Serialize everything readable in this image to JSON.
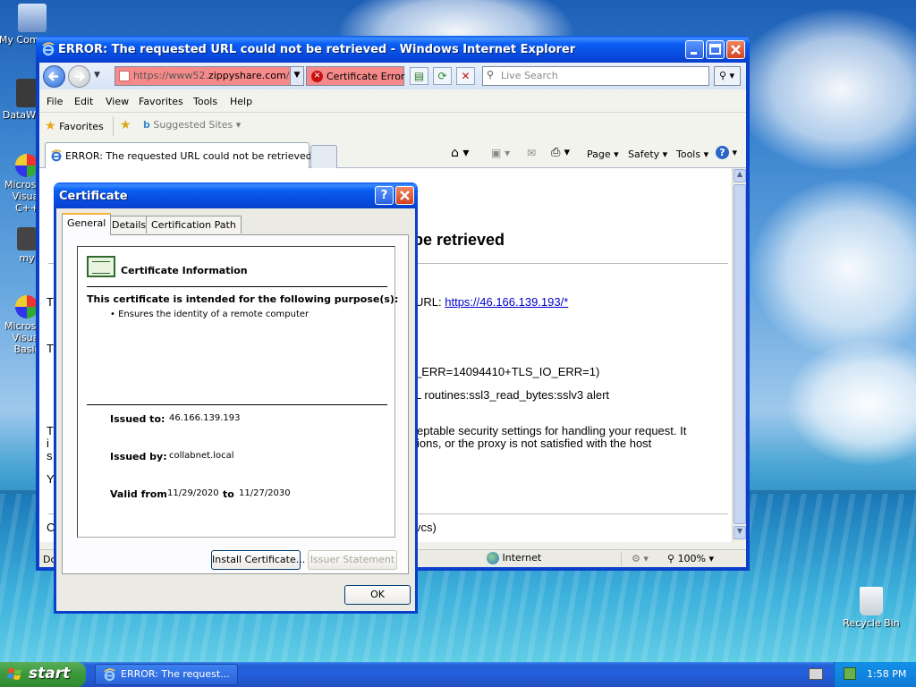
{
  "desktop": {
    "icons": [
      {
        "label": "My Computer",
        "name": "my-computer"
      },
      {
        "label": "DataWare",
        "name": "dataware"
      },
      {
        "label": "Microsoft Visual C++",
        "name": "microsoft-visual-cpp"
      },
      {
        "label": "my",
        "name": "my-shortcut"
      },
      {
        "label": "Microsoft Visual Basic",
        "name": "microsoft-visual-basic"
      },
      {
        "label": "Recycle Bin",
        "name": "recycle-bin"
      }
    ]
  },
  "ie_window": {
    "title": "ERROR: The requested URL could not be retrieved - Windows Internet Explorer",
    "address_prefix": "https://www52.",
    "address_host": "zippyshare.com",
    "address_suffix": "/v/",
    "cert_error": "Certificate Error",
    "search_placeholder": "Live Search",
    "menu": [
      "File",
      "Edit",
      "View",
      "Favorites",
      "Tools",
      "Help"
    ],
    "favorites_label": "Favorites",
    "suggested_sites": "Suggested Sites",
    "tab_title": "ERROR: The requested URL could not be retrieved",
    "commands": {
      "page": "Page",
      "safety": "Safety",
      "tools": "Tools"
    },
    "page": {
      "heading": "be retrieved",
      "url_line_prefix": "URL: ",
      "url_link": "https://46.166.139.193/*",
      "err_line1": "_ERR=14094410+TLS_IO_ERR=1)",
      "err_line2": "L routines:ssl3_read_bytes:sslv3 alert",
      "para_line1": "eptable security settings for handling your request. It",
      "para_line2": "ions, or the proxy is not satisfied with the host",
      "footer_frag": "vcs)"
    },
    "status": {
      "left": "Dor",
      "zone": "Internet",
      "zoom": "100%"
    }
  },
  "cert_dialog": {
    "title": "Certificate",
    "tabs": [
      "General",
      "Details",
      "Certification Path"
    ],
    "info_title": "Certificate Information",
    "purpose_heading": "This certificate is intended for the following purpose(s):",
    "purpose_item": "• Ensures the identity of a remote computer",
    "issued_to_label": "Issued to:",
    "issued_to": "46.166.139.193",
    "issued_by_label": "Issued by:",
    "issued_by": "collabnet.local",
    "valid_from_label": "Valid from",
    "valid_from": "11/29/2020",
    "valid_to_label": "to",
    "valid_to": "11/27/2030",
    "install_button": "Install Certificate...",
    "issuer_button": "Issuer Statement",
    "ok_button": "OK"
  },
  "taskbar": {
    "start": "start",
    "task_label": "ERROR: The request...",
    "clock": "1:58 PM"
  },
  "colors": {
    "cert_error_bg": "#f68a8a",
    "title_bar": "#0a58ec",
    "taskbar": "#245edb"
  }
}
